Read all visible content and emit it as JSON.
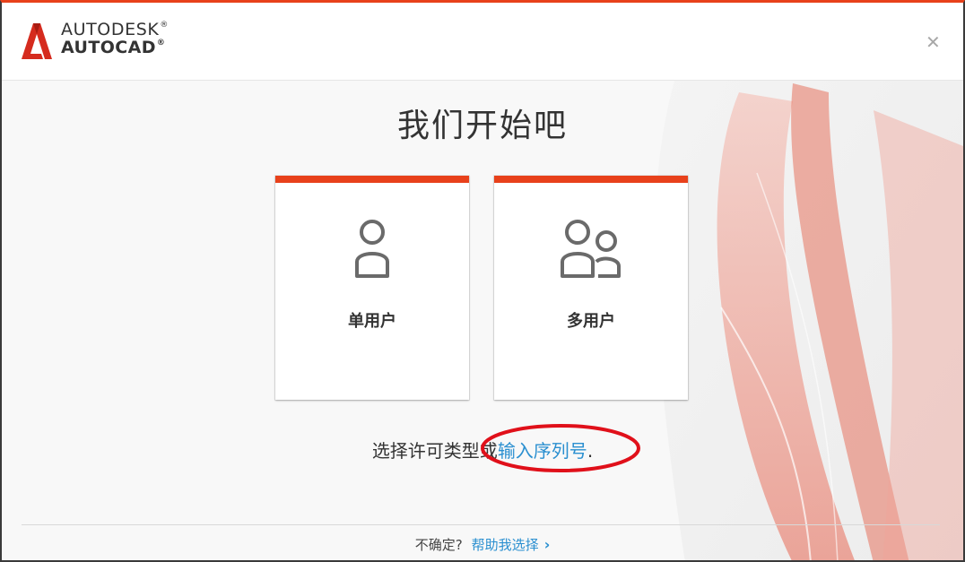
{
  "header": {
    "brand_line1": "AUTODESK",
    "brand_line2": "AUTOCAD",
    "registered": "®",
    "close_icon": "close-icon"
  },
  "main": {
    "title": "我们开始吧",
    "cards": [
      {
        "label": "单用户",
        "icon": "single-user-icon"
      },
      {
        "label": "多用户",
        "icon": "multi-user-icon"
      }
    ],
    "hint_prefix": "选择许可类型或",
    "hint_link": "输入序列号",
    "hint_suffix": "."
  },
  "footer": {
    "question": "不确定?",
    "help_link": "帮助我选择",
    "chevron": "›"
  },
  "colors": {
    "accent": "#e8411b",
    "link": "#2a8fd0",
    "annotation": "#e0101a"
  }
}
